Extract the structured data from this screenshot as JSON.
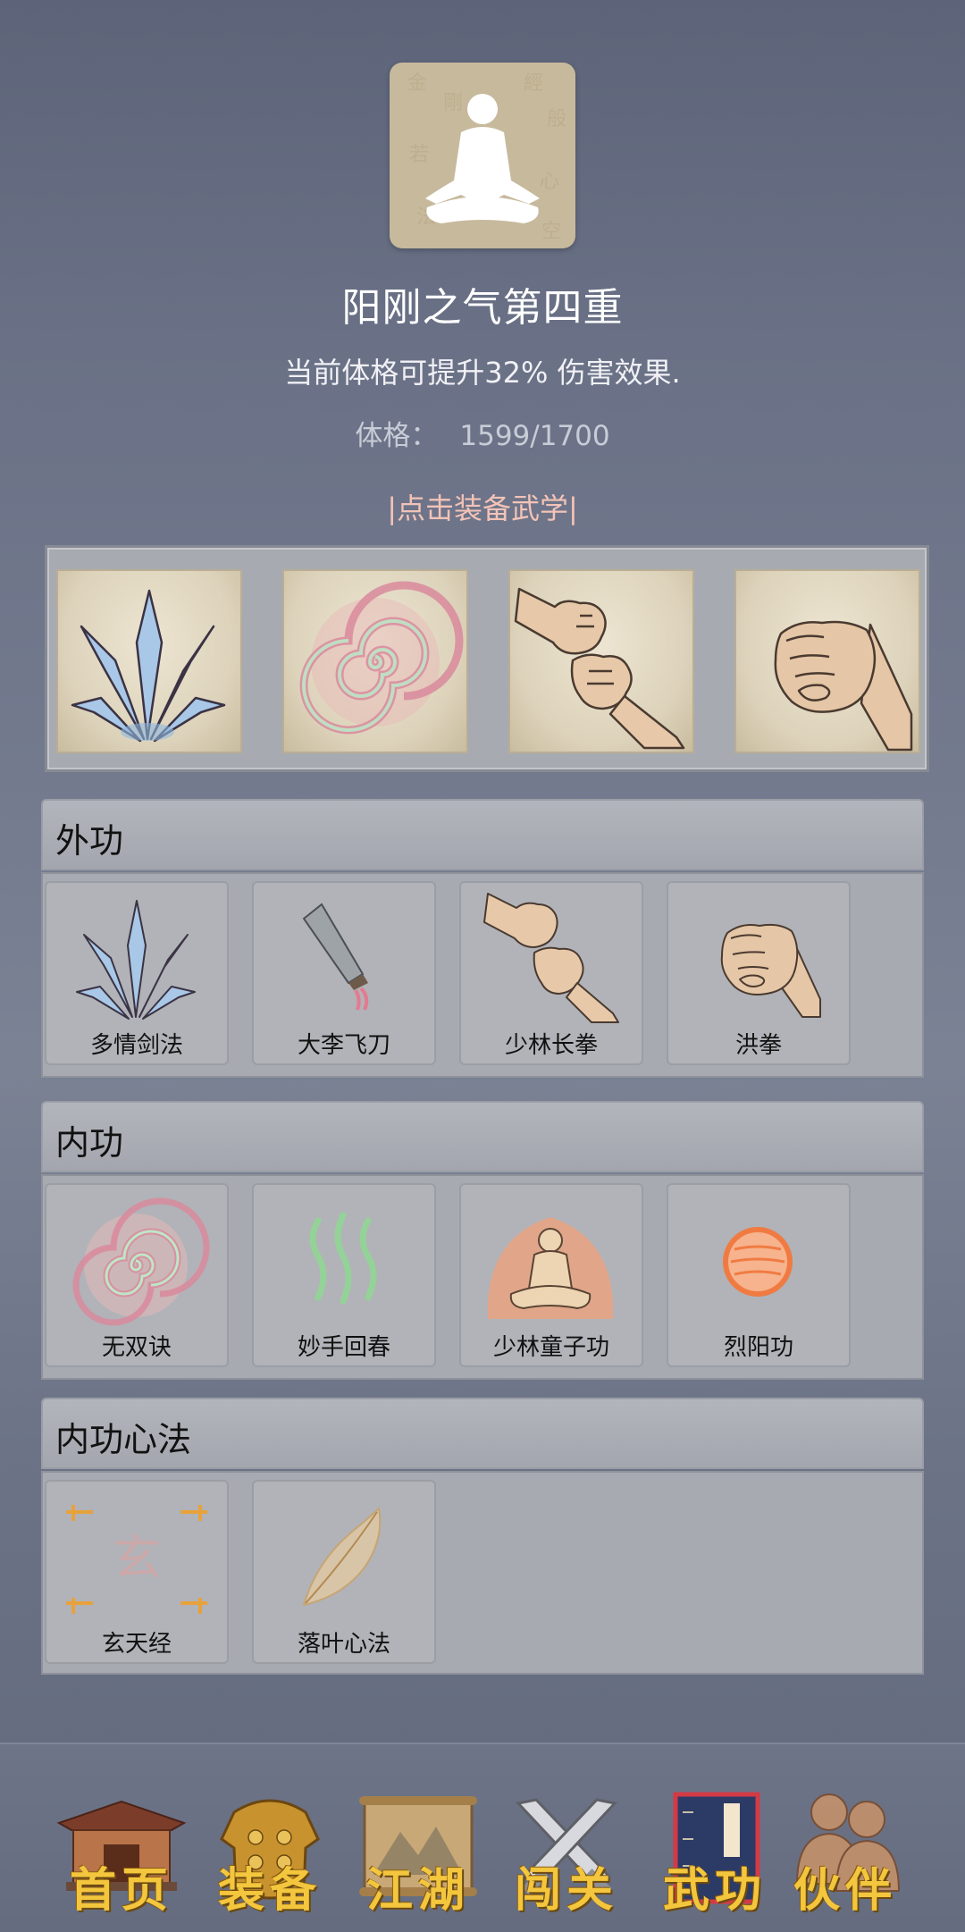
{
  "header": {
    "avatar_icon": "meditation-silhouette",
    "title": "阳刚之气第四重",
    "subtitle": "当前体格可提升32% 伤害效果.",
    "stat_label": "体格：",
    "stat_value": "1599/1700",
    "equip_link": "|点击装备武学|"
  },
  "equipped": {
    "slots": [
      {
        "icon": "sword-fan-icon"
      },
      {
        "icon": "spiral-qi-icon"
      },
      {
        "icon": "fists-icon"
      },
      {
        "icon": "fist-icon"
      }
    ]
  },
  "sections": {
    "waigong": {
      "title": "外功",
      "items": [
        {
          "label": "多情剑法",
          "icon": "sword-fan-icon"
        },
        {
          "label": "大李飞刀",
          "icon": "flying-knife-icon"
        },
        {
          "label": "少林长拳",
          "icon": "fists-icon"
        },
        {
          "label": "洪拳",
          "icon": "fist-icon"
        }
      ]
    },
    "neigong": {
      "title": "内功",
      "items": [
        {
          "label": "无双诀",
          "icon": "spiral-qi-icon"
        },
        {
          "label": "妙手回春",
          "icon": "healing-waves-icon"
        },
        {
          "label": "少林童子功",
          "icon": "meditating-monk-icon"
        },
        {
          "label": "烈阳功",
          "icon": "sun-orb-icon"
        }
      ]
    },
    "xinfa": {
      "title": "内功心法",
      "items": [
        {
          "label": "玄天经",
          "icon": "xuan-scroll-icon"
        },
        {
          "label": "落叶心法",
          "icon": "leaf-icon"
        }
      ]
    }
  },
  "nav": {
    "items": [
      {
        "label": "首页",
        "icon": "pavilion-icon"
      },
      {
        "label": "装备",
        "icon": "armor-icon"
      },
      {
        "label": "江湖",
        "icon": "map-scroll-icon"
      },
      {
        "label": "闯关",
        "icon": "crossed-swords-icon"
      },
      {
        "label": "武功",
        "icon": "martial-book-icon"
      },
      {
        "label": "伙伴",
        "icon": "companions-icon"
      }
    ]
  },
  "colors": {
    "background": "#6a7186",
    "equip_link": "#f3c3b7",
    "nav_label": "#f3c63d",
    "panel": "#a7aab1"
  }
}
